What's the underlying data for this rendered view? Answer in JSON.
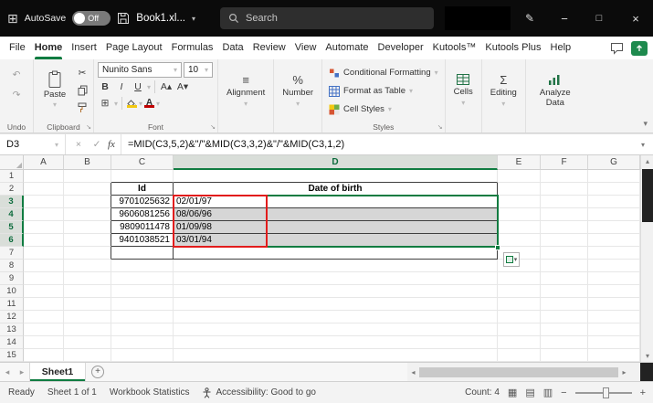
{
  "icons": {
    "app_grid": "⊞",
    "dropdown": "▾",
    "pen": "✎",
    "minimize": "−",
    "maximize": "□",
    "close": "×",
    "undo": "↶",
    "redo": "↷",
    "cut": "✂",
    "borders": "⊞",
    "align": "≡",
    "percent": "%",
    "editing_sigma": "Σ",
    "bold": "B",
    "italic": "I",
    "underline": "U",
    "font_up": "A▴",
    "font_down": "A▾",
    "fx": "fx",
    "cancel": "×",
    "enter": "✓",
    "launcher": "↘",
    "corner_triangle": "◢",
    "nav_left": "◂",
    "nav_right": "▸",
    "scroll_up": "▴",
    "scroll_down": "▾",
    "add_sheet": "+",
    "view_normal": "▦",
    "view_layout": "▤",
    "view_break": "▥",
    "zoom_out": "−",
    "zoom_in": "+"
  },
  "title_bar": {
    "autosave_label": "AutoSave",
    "autosave_state": "Off",
    "file_name": "Book1.xl...",
    "search_placeholder": "Search"
  },
  "menu": {
    "items": [
      "File",
      "Home",
      "Insert",
      "Page Layout",
      "Formulas",
      "Data",
      "Review",
      "View",
      "Automate",
      "Developer",
      "Kutools™",
      "Kutools Plus",
      "Help"
    ],
    "active": "Home"
  },
  "ribbon": {
    "undo": {
      "label": "Undo"
    },
    "clipboard": {
      "label": "Clipboard",
      "paste_label": "Paste"
    },
    "font": {
      "label": "Font",
      "font_name": "Nunito Sans",
      "font_size": "10"
    },
    "alignment": {
      "label": "Alignment"
    },
    "number": {
      "label": "Number"
    },
    "styles": {
      "label": "Styles",
      "conditional_formatting": "Conditional Formatting",
      "format_as_table": "Format as Table",
      "cell_styles": "Cell Styles"
    },
    "cells": {
      "label": "Cells"
    },
    "editing": {
      "label": "Editing"
    },
    "analyze": {
      "label": "Analyze Data"
    }
  },
  "formula_bar": {
    "name_box": "D3",
    "formula": "=MID(C3,5,2)&\"/\"&MID(C3,3,2)&\"/\"&MID(C3,1,2)"
  },
  "grid": {
    "columns": [
      "A",
      "B",
      "C",
      "D",
      "E",
      "F",
      "G"
    ],
    "row_numbers": [
      "1",
      "2",
      "3",
      "4",
      "5",
      "6",
      "7",
      "8",
      "9",
      "10",
      "11",
      "12",
      "13",
      "14",
      "15"
    ],
    "selected_column": "D",
    "selected_rows": [
      "3",
      "4",
      "5",
      "6"
    ],
    "active_cell": "D3",
    "cells": {
      "C2": "Id",
      "D2": "Date of birth",
      "C3": "9701025632",
      "D3": "02/01/97",
      "C4": "9606081256",
      "D4": "08/06/96",
      "C5": "9809011478",
      "D5": "01/09/98",
      "C6": "9401038521",
      "D6": "03/01/94"
    }
  },
  "sheet_bar": {
    "tabs": [
      "Sheet1"
    ]
  },
  "status_bar": {
    "ready": "Ready",
    "sheet_info": "Sheet 1 of 1",
    "workbook_statistics": "Workbook Statistics",
    "accessibility": "Accessibility: Good to go",
    "count": "Count: 4"
  }
}
